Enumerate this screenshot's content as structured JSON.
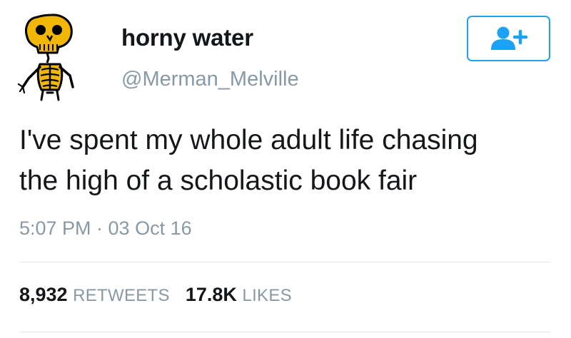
{
  "tweet": {
    "display_name": "horny water",
    "handle": "@Merman_Melville",
    "text_lines": [
      "I've spent my whole adult life chasing",
      "the high of a scholastic book fair"
    ],
    "timestamp": "5:07 PM · 03 Oct 16",
    "stats": {
      "retweets_count": "8,932",
      "retweets_label": "RETWEETS",
      "likes_count": "17.8K",
      "likes_label": "LIKES"
    }
  },
  "icons": {
    "avatar": "skeleton-avatar",
    "follow": "add-user-icon"
  },
  "colors": {
    "accent": "#1da1f2",
    "text_primary": "#14171a",
    "text_secondary": "#8899a6",
    "divider": "#e1e8ed",
    "avatar_bone": "#f2b705"
  }
}
